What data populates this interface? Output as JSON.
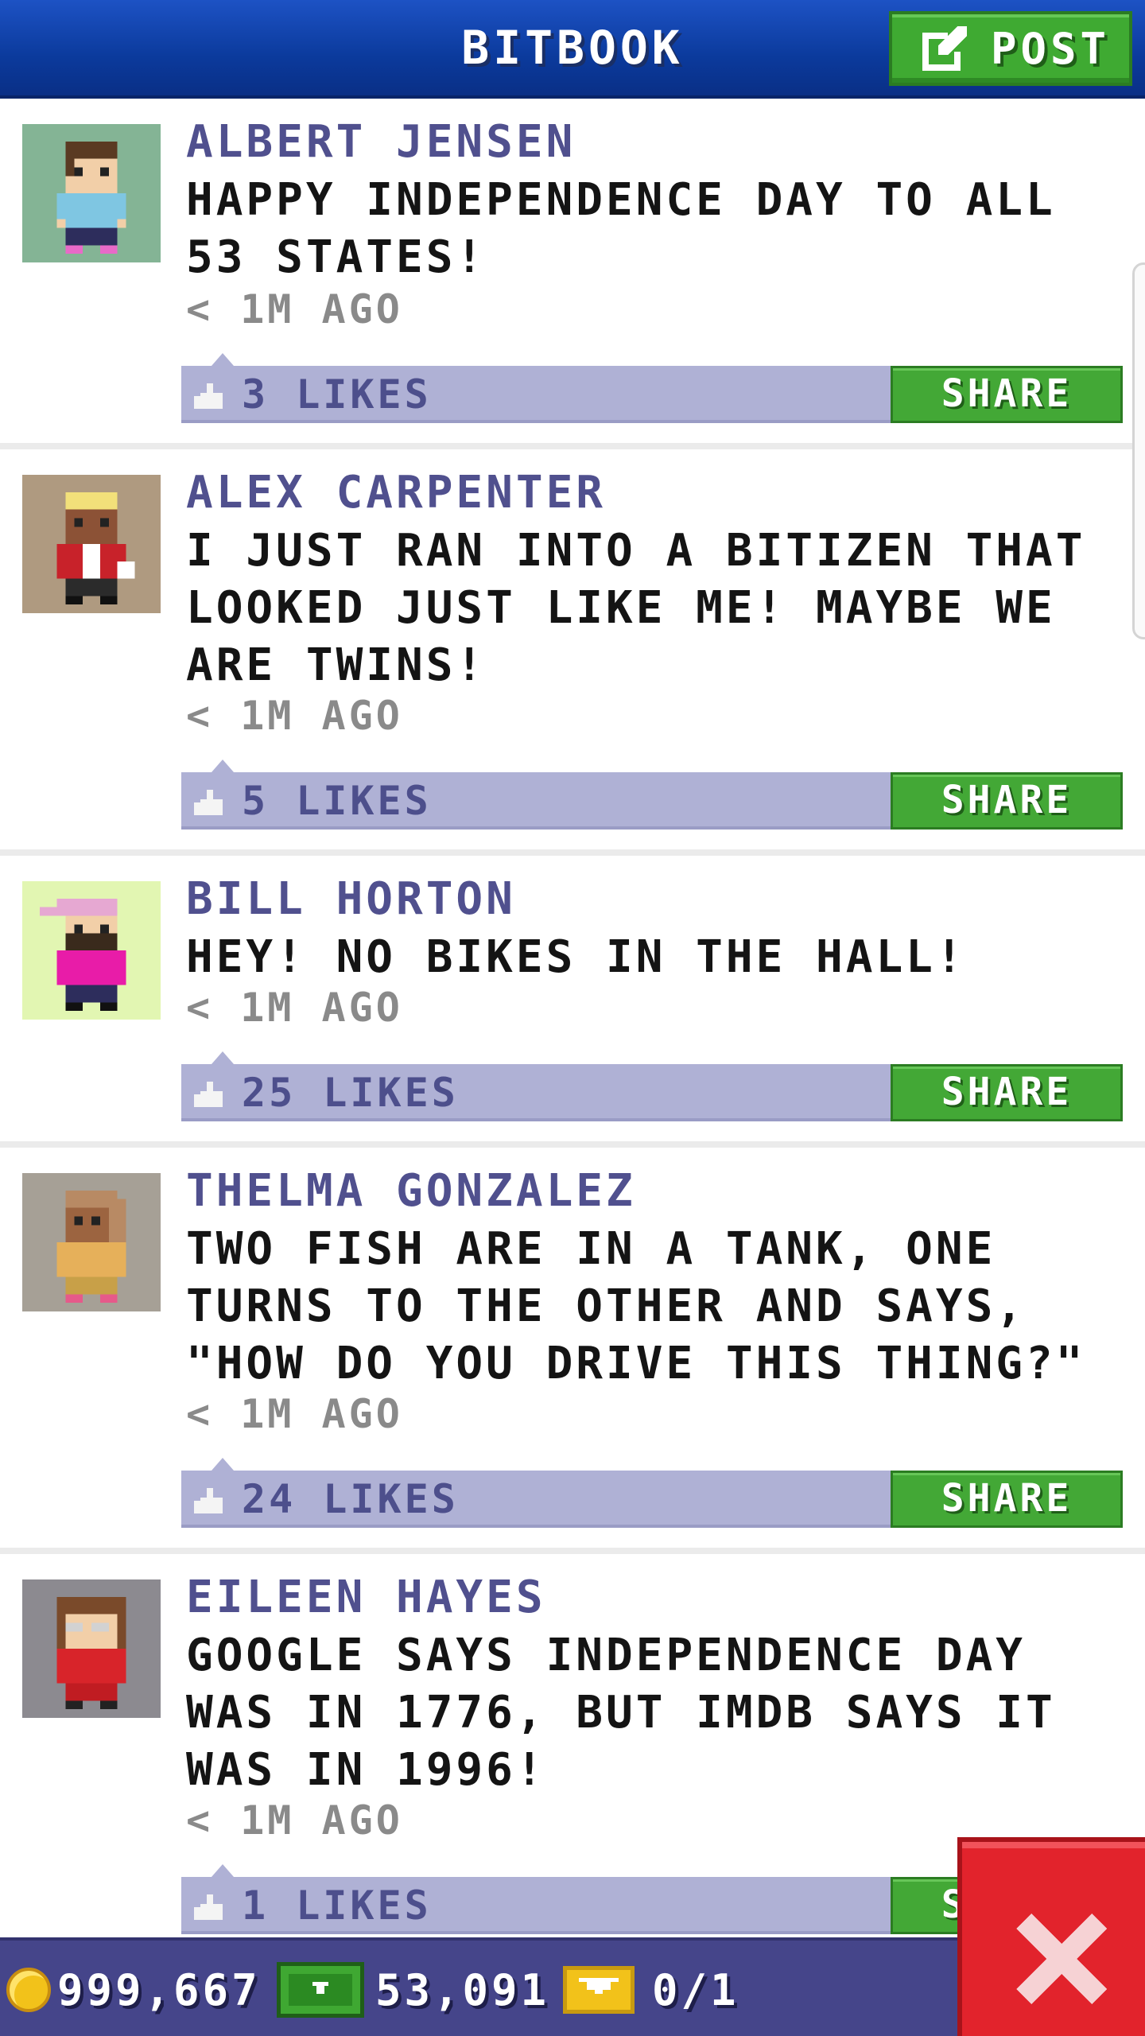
{
  "header": {
    "title": "BITBOOK",
    "post_label": "POST"
  },
  "feed": {
    "share_label": "SHARE",
    "posts": [
      {
        "name": "ALBERT JENSEN",
        "text": "HAPPY INDEPENDENCE DAY TO ALL 53 STATES!",
        "time": "< 1M AGO",
        "likes": "3 LIKES",
        "avatar_icon": "avatar-albert-icon"
      },
      {
        "name": "ALEX CARPENTER",
        "text": "I JUST RAN INTO A BITIZEN THAT LOOKED JUST LIKE ME! MAYBE WE ARE TWINS!",
        "time": "< 1M AGO",
        "likes": "5 LIKES",
        "avatar_icon": "avatar-alex-icon"
      },
      {
        "name": "BILL HORTON",
        "text": "HEY! NO BIKES IN THE HALL!",
        "time": "< 1M AGO",
        "likes": "25 LIKES",
        "avatar_icon": "avatar-bill-icon"
      },
      {
        "name": "THELMA GONZALEZ",
        "text": "TWO FISH ARE IN A TANK, ONE TURNS TO THE OTHER AND SAYS, \"HOW DO YOU DRIVE THIS THING?\"",
        "time": "< 1M AGO",
        "likes": "24 LIKES",
        "avatar_icon": "avatar-thelma-icon"
      },
      {
        "name": "EILEEN HAYES",
        "text": "GOOGLE SAYS INDEPENDENCE DAY WAS IN 1776, BUT IMDB SAYS IT WAS IN 1996!",
        "time": "< 1M AGO",
        "likes": "1 LIKES",
        "avatar_icon": "avatar-eileen-icon"
      }
    ]
  },
  "bottom_bar": {
    "coins": "999,667",
    "bux": "53,091",
    "tickets": "0/1"
  },
  "colors": {
    "header_blue": "#0b3a9c",
    "share_green": "#43a836",
    "like_bar": "#afb1d5",
    "name_purple": "#50508e",
    "close_red": "#e2232c",
    "bottom_bar": "#45458a"
  }
}
